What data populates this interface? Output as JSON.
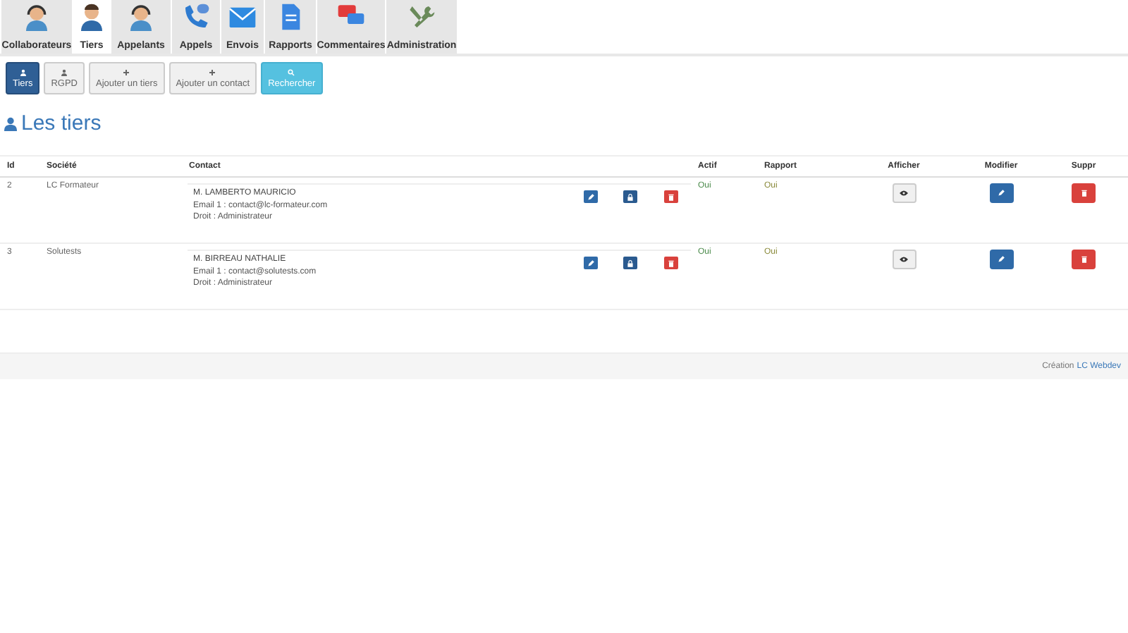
{
  "tabs": [
    {
      "label": "Collaborateurs",
      "kind": "headset",
      "selected": false
    },
    {
      "label": "Tiers",
      "kind": "person",
      "selected": true
    },
    {
      "label": "Appelants",
      "kind": "headset",
      "selected": false
    },
    {
      "label": "Appels",
      "kind": "phone",
      "selected": false
    },
    {
      "label": "Envois",
      "kind": "mail",
      "selected": false
    },
    {
      "label": "Rapports",
      "kind": "doc",
      "selected": false
    },
    {
      "label": "Commentaires",
      "kind": "chat",
      "selected": false
    },
    {
      "label": "Administration",
      "kind": "tools",
      "selected": false
    }
  ],
  "subnav": [
    {
      "label": "Tiers",
      "kind": "person",
      "selected": true
    },
    {
      "label": "RGPD",
      "kind": "person",
      "selected": false
    },
    {
      "label": "Ajouter un tiers",
      "kind": "plus",
      "selected": false
    },
    {
      "label": "Ajouter un contact",
      "kind": "plus",
      "selected": false
    },
    {
      "label": "Rechercher",
      "kind": "search",
      "selected": false
    }
  ],
  "page_title": "Les tiers",
  "table": {
    "columns": [
      "Id",
      "Société",
      "Contact",
      "Actif",
      "Rapport",
      "Afficher",
      "Modifier",
      "Suppr"
    ],
    "rows": [
      {
        "id": "2",
        "societe": "LC Formateur",
        "contact": {
          "name": "M. LAMBERTO MAURICIO",
          "email": "Email 1 : contact@lc-formateur.com",
          "droit": "Droit : Administrateur"
        },
        "actif": "Oui",
        "rapport": "Oui"
      },
      {
        "id": "3",
        "societe": "Solutests",
        "contact": {
          "name": "M. BIRREAU NATHALIE",
          "email": "Email 1 : contact@solutests.com",
          "droit": "Droit : Administrateur"
        },
        "actif": "Oui",
        "rapport": "Oui"
      }
    ]
  },
  "footer": {
    "text": "Création",
    "link": "LC Webdev"
  }
}
